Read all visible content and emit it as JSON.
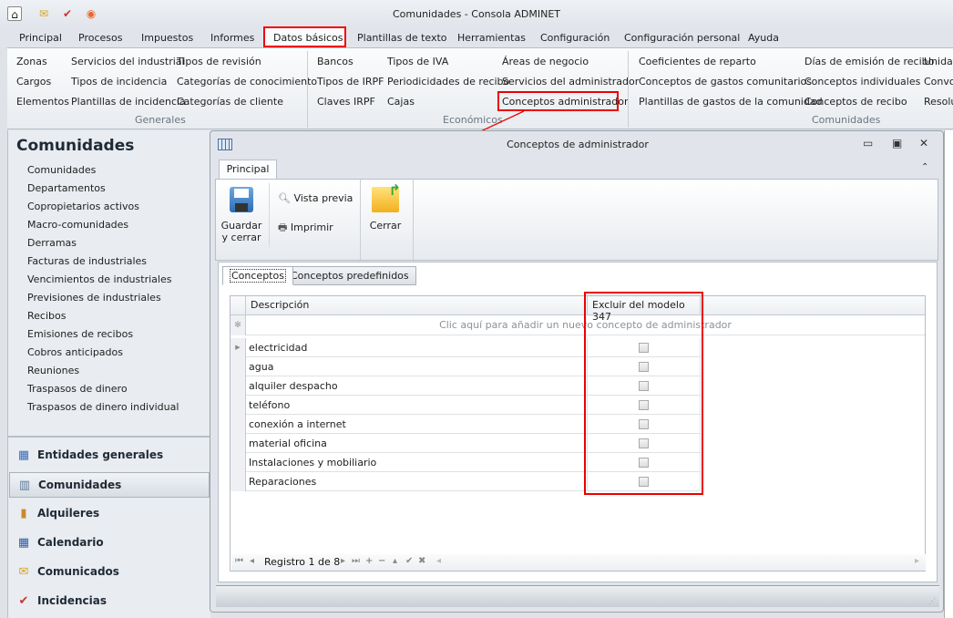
{
  "app": {
    "title": "Comunidades - Consola ADMINET"
  },
  "quick_access": [
    "home-icon",
    "mail-icon",
    "clipboard-check-icon",
    "broadcast-icon"
  ],
  "menu": [
    "Principal",
    "Procesos",
    "Impuestos",
    "Informes",
    "Datos básicos",
    "Plantillas de texto",
    "Herramientas",
    "Configuración",
    "Configuración personal",
    "Ayuda"
  ],
  "ribbon": {
    "generales": {
      "label": "Generales",
      "col1": [
        "Zonas",
        "Cargos",
        "Elementos"
      ],
      "col2": [
        "Servicios del industrial",
        "Tipos de incidencia",
        "Plantillas de incidencia"
      ],
      "col3": [
        "Tipos de revisión",
        "Categorías de conocimiento",
        "Categorías de cliente"
      ]
    },
    "economicos": {
      "label": "Económicos",
      "col1": [
        "Bancos",
        "Tipos de IRPF",
        "Claves IRPF"
      ],
      "col2": [
        "Tipos de IVA",
        "Periodicidades de recibo",
        "Cajas"
      ],
      "col3": [
        "Áreas de negocio",
        "Servicios del administrador",
        "Conceptos administrador"
      ]
    },
    "comunidades": {
      "label": "Comunidades",
      "col1": [
        "Coeficientes de reparto",
        "Conceptos de gastos comunitarios",
        "Plantillas de gastos de la comunidad"
      ],
      "col2": [
        "Días de emisión de recibo",
        "Conceptos individuales",
        "Conceptos de recibo"
      ],
      "col3": [
        "Unidad",
        "Convo",
        "Resolu"
      ]
    }
  },
  "sidebar": {
    "title": "Comunidades",
    "items": [
      "Comunidades",
      "Departamentos",
      "Copropietarios activos",
      "Macro-comunidades",
      "Derramas",
      "Facturas de industriales",
      "Vencimientos de industriales",
      "Previsiones de industriales",
      "Recibos",
      "Emisiones de recibos",
      "Cobros anticipados",
      "Reuniones",
      "Traspasos de dinero",
      "Traspasos de dinero individual"
    ],
    "nav": [
      {
        "label": "Entidades generales",
        "icon": "table-icon"
      },
      {
        "label": "Comunidades",
        "icon": "building-icon"
      },
      {
        "label": "Alquileres",
        "icon": "door-icon"
      },
      {
        "label": "Calendario",
        "icon": "calendar-icon"
      },
      {
        "label": "Comunicados",
        "icon": "mail-icon"
      },
      {
        "label": "Incidencias",
        "icon": "clipboard-check-icon"
      }
    ]
  },
  "dialog": {
    "title": "Conceptos de administrador",
    "ribbon_tab": "Principal",
    "buttons": {
      "save": "Guardar y cerrar",
      "preview": "Vista previa",
      "print": "Imprimir",
      "close": "Cerrar"
    },
    "tabs": [
      "Conceptos",
      "Conceptos predefinidos"
    ],
    "grid": {
      "columns": [
        "Descripción",
        "Excluir del modelo 347"
      ],
      "new_row_hint": "Clic aquí para añadir un nuevo concepto de administrador",
      "rows": [
        {
          "desc": "electricidad",
          "excluded": false
        },
        {
          "desc": "agua",
          "excluded": false
        },
        {
          "desc": "alquiler despacho",
          "excluded": false
        },
        {
          "desc": "teléfono",
          "excluded": false
        },
        {
          "desc": "conexión a internet",
          "excluded": false
        },
        {
          "desc": "material oficina",
          "excluded": false
        },
        {
          "desc": "Instalaciones y mobiliario",
          "excluded": false
        },
        {
          "desc": "Reparaciones",
          "excluded": false
        }
      ]
    },
    "navigator": "Registro 1 de 8"
  },
  "colors": {
    "highlight": "#e00000",
    "accent": "#1e2a36"
  }
}
